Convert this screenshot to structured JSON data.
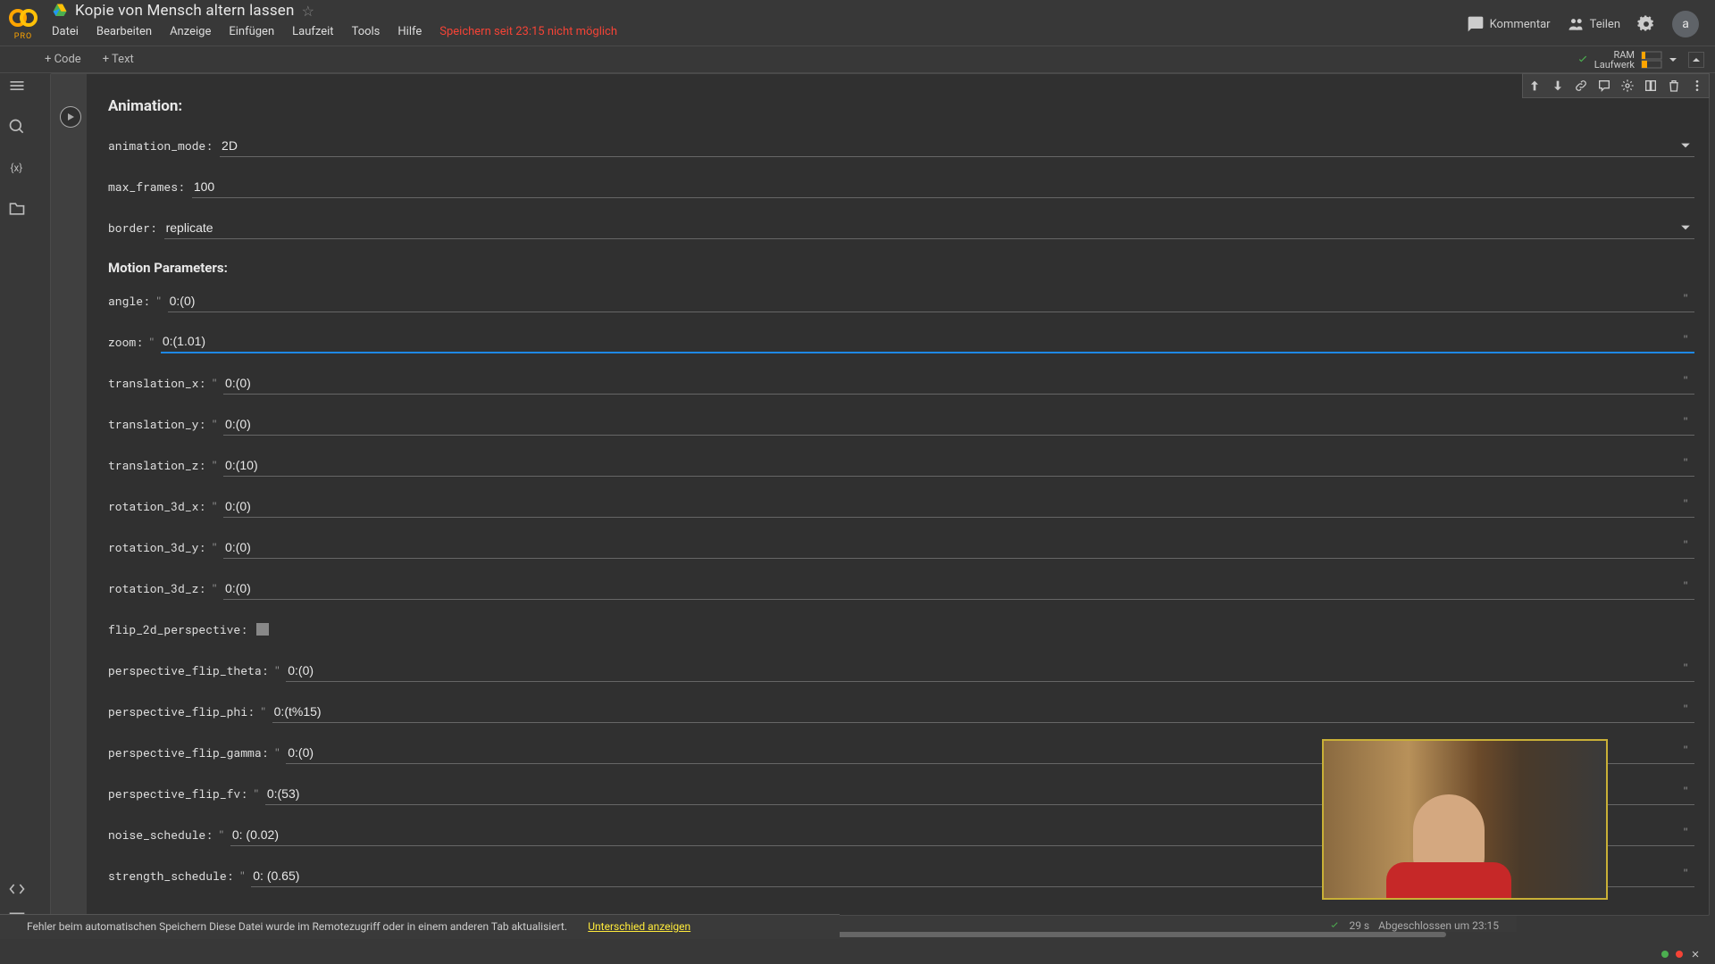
{
  "header": {
    "pro": "PRO",
    "title": "Kopie von Mensch altern lassen",
    "menu": [
      "Datei",
      "Bearbeiten",
      "Anzeige",
      "Einfügen",
      "Laufzeit",
      "Tools",
      "Hilfe"
    ],
    "save_warn": "Speichern seit 23:15 nicht möglich",
    "comment": "Kommentar",
    "share": "Teilen",
    "avatar": "a"
  },
  "toolbar": {
    "code": "+ Code",
    "text": "+ Text",
    "ram": "RAM",
    "disk": "Laufwerk"
  },
  "form": {
    "section1": "Animation:",
    "section2": "Motion Parameters:",
    "rows": {
      "animation_mode": {
        "label": "animation_mode:",
        "value": "2D",
        "type": "select"
      },
      "max_frames": {
        "label": "max_frames:",
        "value": "100",
        "type": "text",
        "noquote": true
      },
      "border": {
        "label": "border:",
        "value": "replicate",
        "type": "select"
      },
      "angle": {
        "label": "angle:",
        "value": "0:(0)",
        "type": "qtext"
      },
      "zoom": {
        "label": "zoom:",
        "value": "0:(1.01)",
        "type": "qtext",
        "active": true
      },
      "translation_x": {
        "label": "translation_x:",
        "value": "0:(0)",
        "type": "qtext"
      },
      "translation_y": {
        "label": "translation_y:",
        "value": "0:(0)",
        "type": "qtext"
      },
      "translation_z": {
        "label": "translation_z:",
        "value": "0:(10)",
        "type": "qtext"
      },
      "rotation_3d_x": {
        "label": "rotation_3d_x:",
        "value": "0:(0)",
        "type": "qtext"
      },
      "rotation_3d_y": {
        "label": "rotation_3d_y:",
        "value": "0:(0)",
        "type": "qtext"
      },
      "rotation_3d_z": {
        "label": "rotation_3d_z:",
        "value": "0:(0)",
        "type": "qtext"
      },
      "flip_2d_perspective": {
        "label": "flip_2d_perspective:",
        "type": "check"
      },
      "perspective_flip_theta": {
        "label": "perspective_flip_theta:",
        "value": "0:(0)",
        "type": "qtext"
      },
      "perspective_flip_phi": {
        "label": "perspective_flip_phi:",
        "value": "0:(t%15)",
        "type": "qtext"
      },
      "perspective_flip_gamma": {
        "label": "perspective_flip_gamma:",
        "value": "0:(0)",
        "type": "qtext"
      },
      "perspective_flip_fv": {
        "label": "perspective_flip_fv:",
        "value": "0:(53)",
        "type": "qtext"
      },
      "noise_schedule": {
        "label": "noise_schedule:",
        "value": "0: (0.02)",
        "type": "qtext"
      },
      "strength_schedule": {
        "label": "strength_schedule:",
        "value": "0: (0.65)",
        "type": "qtext"
      }
    }
  },
  "status": {
    "error_msg": "Fehler beim automatischen Speichern Diese Datei wurde im Remotezugriff oder in einem anderen Tab aktualisiert.",
    "diff_link": "Unterschied anzeigen",
    "exec_time": "29 s",
    "completed": "Abgeschlossen um 23:15"
  }
}
